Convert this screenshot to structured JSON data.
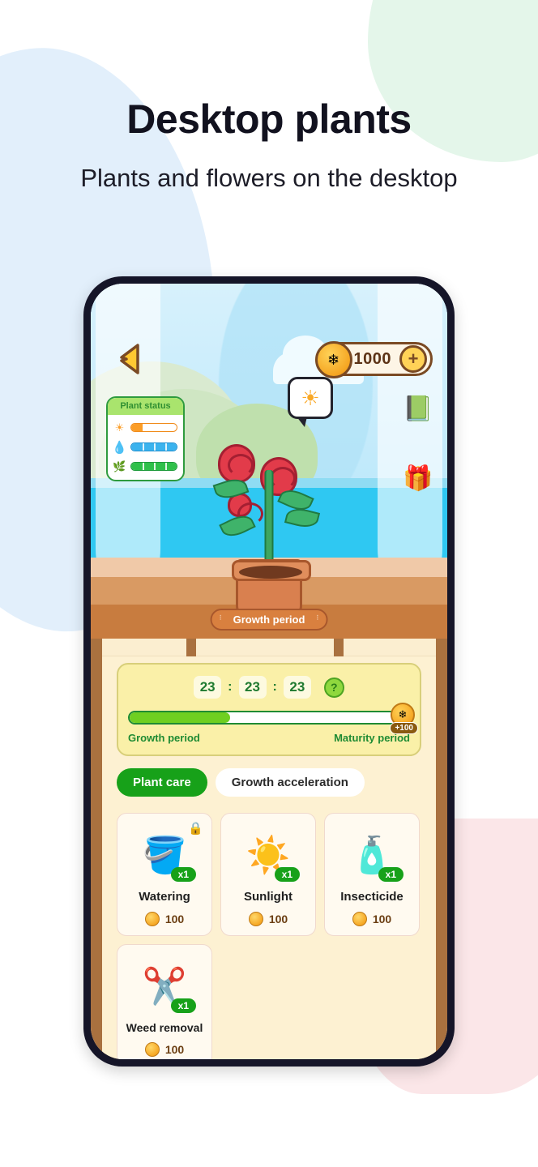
{
  "header": {
    "title": "Desktop plants",
    "subtitle": "Plants and flowers on the desktop"
  },
  "scene": {
    "back_icon": "back-arrow-icon",
    "coins": {
      "coin_icon": "coin-icon",
      "amount": "1000",
      "add_label": "+"
    },
    "plant_status": {
      "title": "Plant status",
      "bars": [
        {
          "icon": "sun-icon",
          "glyph": "☀",
          "segments": 4,
          "filled": 1,
          "kind": "sun"
        },
        {
          "icon": "water-drop-icon",
          "glyph": "●",
          "segments": 4,
          "filled": 4,
          "kind": "water"
        },
        {
          "icon": "leaf-icon",
          "glyph": "❦",
          "segments": 4,
          "filled": 4,
          "kind": "leaf"
        }
      ]
    },
    "sun_bubble": {
      "icon": "sun-icon",
      "glyph": "☀"
    },
    "side_icons": [
      {
        "name": "tasks-icon",
        "glyph": "📗"
      },
      {
        "name": "gift-icon",
        "glyph": "🎁"
      }
    ],
    "growth_tab_label": "Growth period"
  },
  "timer": {
    "hours": "23",
    "minutes": "23",
    "seconds": "23",
    "separator": ":",
    "help_label": "?",
    "progress_percent": 36,
    "reward_badge": "+100",
    "reward_coin_icon": "coin-icon",
    "left_label": "Growth period",
    "right_label": "Maturity period"
  },
  "tabs": [
    {
      "label": "Plant care",
      "active": true
    },
    {
      "label": "Growth acceleration",
      "active": false
    }
  ],
  "items": [
    {
      "name": "Watering",
      "icon": "watering-can-icon",
      "glyph": "🪣",
      "qty": "x1",
      "price": "100",
      "locked": true,
      "lock_glyph": "🔒"
    },
    {
      "name": "Sunlight",
      "icon": "sun-icon",
      "glyph": "☀️",
      "qty": "x1",
      "price": "100",
      "locked": false,
      "lock_glyph": ""
    },
    {
      "name": "Insecticide",
      "icon": "spray-bottle-icon",
      "glyph": "🧴",
      "qty": "x1",
      "price": "100",
      "locked": false,
      "lock_glyph": ""
    },
    {
      "name": "Weed removal",
      "icon": "shears-icon",
      "glyph": "✂️",
      "qty": "x1",
      "price": "100",
      "locked": false,
      "lock_glyph": ""
    }
  ],
  "colors": {
    "accent_green": "#17a119",
    "coin_gold": "#f5a623",
    "phone_frame": "#151528",
    "panel_bg": "#fdf1d2",
    "timer_card": "#faf0a8",
    "blob_blue": "#e2effb",
    "blob_green": "#e4f6ea",
    "blob_pink": "#fbe6e8"
  }
}
